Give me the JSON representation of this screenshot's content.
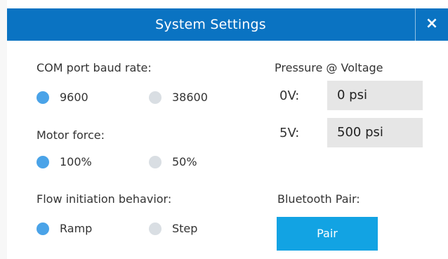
{
  "dialog": {
    "title": "System Settings",
    "close_glyph": "×"
  },
  "baud": {
    "label": "COM port baud rate:",
    "options": [
      {
        "label": "9600",
        "checked": true
      },
      {
        "label": "38600",
        "checked": false
      }
    ]
  },
  "motor": {
    "label": "Motor force:",
    "options": [
      {
        "label": "100%",
        "checked": true
      },
      {
        "label": "50%",
        "checked": false
      }
    ]
  },
  "flow": {
    "label": "Flow initiation behavior:",
    "options": [
      {
        "label": "Ramp",
        "checked": true
      },
      {
        "label": "Step",
        "checked": false
      }
    ]
  },
  "pressure": {
    "label": "Pressure @ Voltage",
    "rows": [
      {
        "voltage": "0V:",
        "value": "0 psi"
      },
      {
        "voltage": "5V:",
        "value": "500 psi"
      }
    ]
  },
  "bluetooth": {
    "label": "Bluetooth Pair:",
    "button_label": "Pair"
  },
  "colors": {
    "titlebar": "#0a73c2",
    "radio_checked": "#4aa3e8",
    "radio_unchecked": "#d9dee3",
    "field_bg": "#e6e6e6",
    "pair_button": "#12a3e3"
  },
  "icons": {
    "close": "close-icon"
  }
}
